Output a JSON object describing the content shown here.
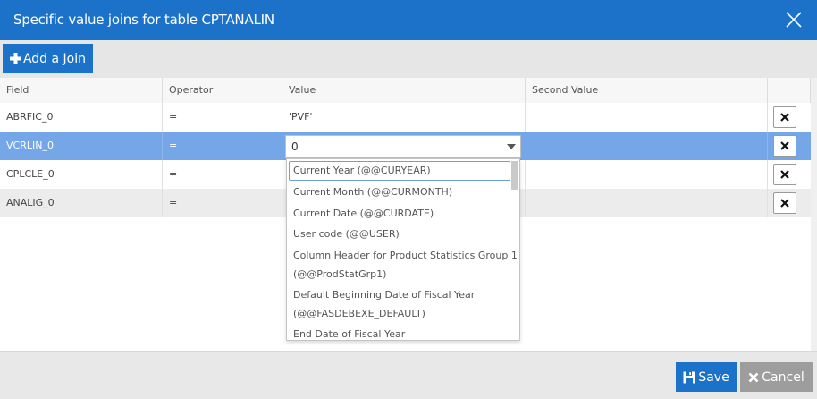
{
  "dialog": {
    "title": "Specific value joins for table CPTANALIN",
    "close_icon": "close-icon"
  },
  "toolbar": {
    "add_join_label": "Add a Join",
    "add_join_icon": "plus-icon"
  },
  "grid": {
    "columns": [
      "Field",
      "Operator",
      "Value",
      "Second Value"
    ],
    "rows": [
      {
        "field": "ABRFIC_0",
        "operator": "=",
        "value": "'PVF'",
        "second_value": ""
      },
      {
        "field": "VCRLIN_0",
        "operator": "=",
        "value": "0",
        "second_value": ""
      },
      {
        "field": "CPLCLE_0",
        "operator": "=",
        "value": "",
        "second_value": ""
      },
      {
        "field": "ANALIG_0",
        "operator": "=",
        "value": "",
        "second_value": ""
      }
    ],
    "delete_icon": "times-icon"
  },
  "dropdown": {
    "options": [
      "Current Year (@@CURYEAR)",
      "Current Month (@@CURMONTH)",
      "Current Date (@@CURDATE)",
      "User code (@@USER)",
      "Column Header for Product Statistics Group 1",
      "(@@ProdStatGrp1)",
      "Default Beginning Date of Fiscal Year",
      "(@@FASDEBEXE_DEFAULT)",
      "End Date of Fiscal Year"
    ]
  },
  "footer": {
    "save_label": "Save",
    "save_icon": "floppy-icon",
    "cancel_label": "Cancel",
    "cancel_icon": "times-icon"
  },
  "colors": {
    "primary": "#1c72c9",
    "selected_row": "#74a6e8",
    "cancel": "#9d9d9d"
  }
}
